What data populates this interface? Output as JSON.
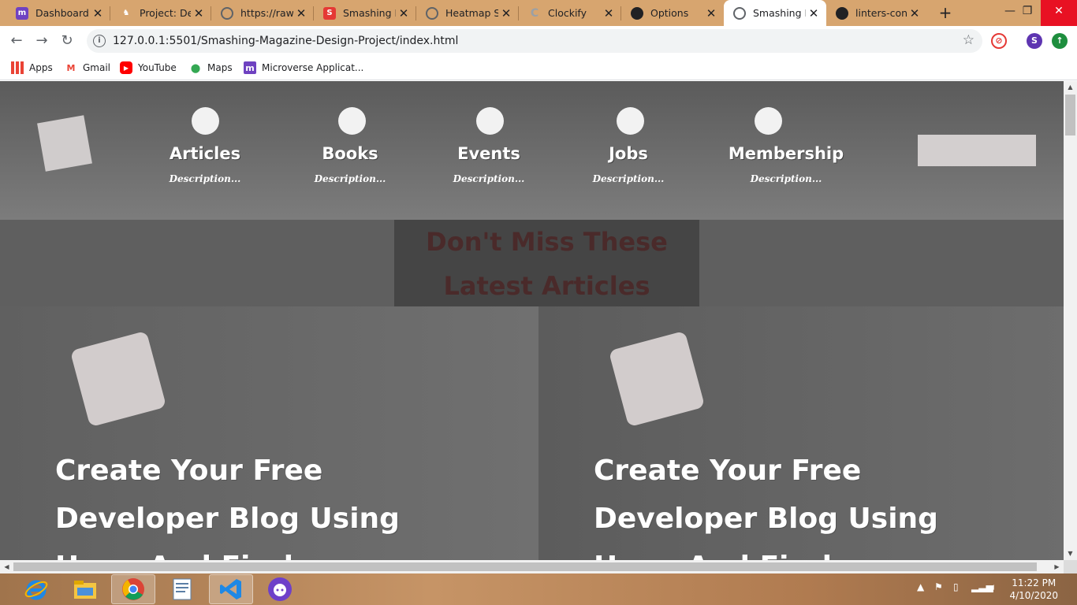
{
  "browser": {
    "tabs": [
      {
        "title": "Dashboard",
        "icon": "microverse-icon",
        "color": "#6f42c1"
      },
      {
        "title": "Project: Design",
        "icon": "project-icon",
        "color": "#d7a56f"
      },
      {
        "title": "https://raw.g",
        "icon": "globe-icon",
        "color": "#5f6368"
      },
      {
        "title": "Smashing Magazine",
        "icon": "smashing-icon",
        "color": "#e53935"
      },
      {
        "title": "Heatmap Smashing",
        "icon": "globe-icon",
        "color": "#5f6368"
      },
      {
        "title": "Clockify",
        "icon": "clockify-icon",
        "color": "#9aa0a6"
      },
      {
        "title": "Options",
        "icon": "github-icon",
        "color": "#202124"
      },
      {
        "title": "Smashing Magazine",
        "icon": "globe-icon",
        "color": "#5f6368"
      },
      {
        "title": "linters-config",
        "icon": "github-icon",
        "color": "#202124"
      }
    ],
    "url": "127.0.0.1:5501/Smashing-Magazine-Design-Project/index.html",
    "profile_initial": "S",
    "bookmarks": [
      {
        "label": "Apps",
        "icon": "apps-grid-icon"
      },
      {
        "label": "Gmail",
        "icon": "gmail-icon"
      },
      {
        "label": "YouTube",
        "icon": "youtube-icon"
      },
      {
        "label": "Maps",
        "icon": "maps-icon"
      },
      {
        "label": "Microverse Applicat...",
        "icon": "microverse-icon"
      }
    ]
  },
  "page": {
    "nav": [
      {
        "label": "Articles",
        "description": "Description..."
      },
      {
        "label": "Books",
        "description": "Description..."
      },
      {
        "label": "Events",
        "description": "Description..."
      },
      {
        "label": "Jobs",
        "description": "Description..."
      },
      {
        "label": "Membership",
        "description": "Description..."
      }
    ],
    "section_title": "Don't Miss These Latest Articles",
    "cards": [
      {
        "title": "Create Your Free Developer Blog Using Hugo And Firebase"
      },
      {
        "title": "Create Your Free Developer Blog Using Hugo And Firebase"
      }
    ]
  },
  "taskbar": {
    "apps": [
      "internet-explorer-icon",
      "file-explorer-icon",
      "chrome-icon",
      "text-editor-icon",
      "vscode-icon",
      "github-desktop-icon"
    ],
    "time": "11:22 PM",
    "date": "4/10/2020"
  }
}
